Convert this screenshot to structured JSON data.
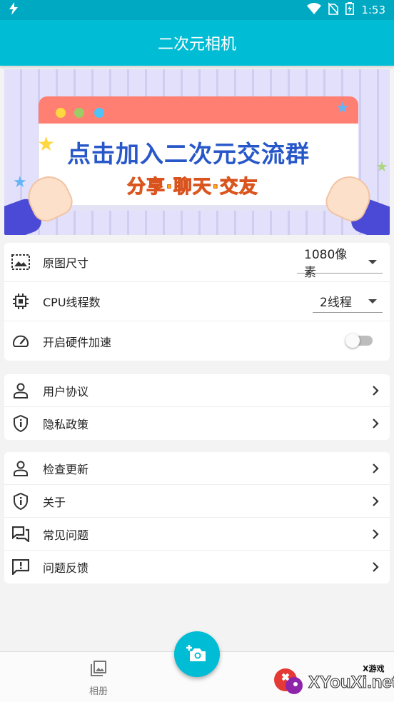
{
  "status_bar": {
    "time": "1:53"
  },
  "app_bar": {
    "title": "二次元相机"
  },
  "banner": {
    "title": "点击加入二次元交流群",
    "subtitle": "分享·聊天·交友"
  },
  "settings": [
    {
      "label": "原图尺寸",
      "value": "1080像素",
      "icon": "image-size-icon"
    },
    {
      "label": "CPU线程数",
      "value": "2线程",
      "icon": "cpu-icon"
    },
    {
      "label": "开启硬件加速",
      "toggle": false,
      "icon": "speedometer-icon"
    }
  ],
  "legal": [
    {
      "label": "用户协议",
      "icon": "person-icon"
    },
    {
      "label": "隐私政策",
      "icon": "shield-info-icon"
    }
  ],
  "about": [
    {
      "label": "检查更新",
      "icon": "person-icon"
    },
    {
      "label": "关于",
      "icon": "shield-info-icon"
    },
    {
      "label": "常见问题",
      "icon": "forum-icon"
    },
    {
      "label": "问题反馈",
      "icon": "feedback-icon"
    }
  ],
  "bottom_nav": {
    "album_label": "相册"
  },
  "watermark": {
    "text": "XYouXi.net",
    "tag": "X游戏"
  },
  "colors": {
    "primary": "#00bcd4",
    "primary_dark": "#00a9c2",
    "background": "#f3f3f3"
  }
}
